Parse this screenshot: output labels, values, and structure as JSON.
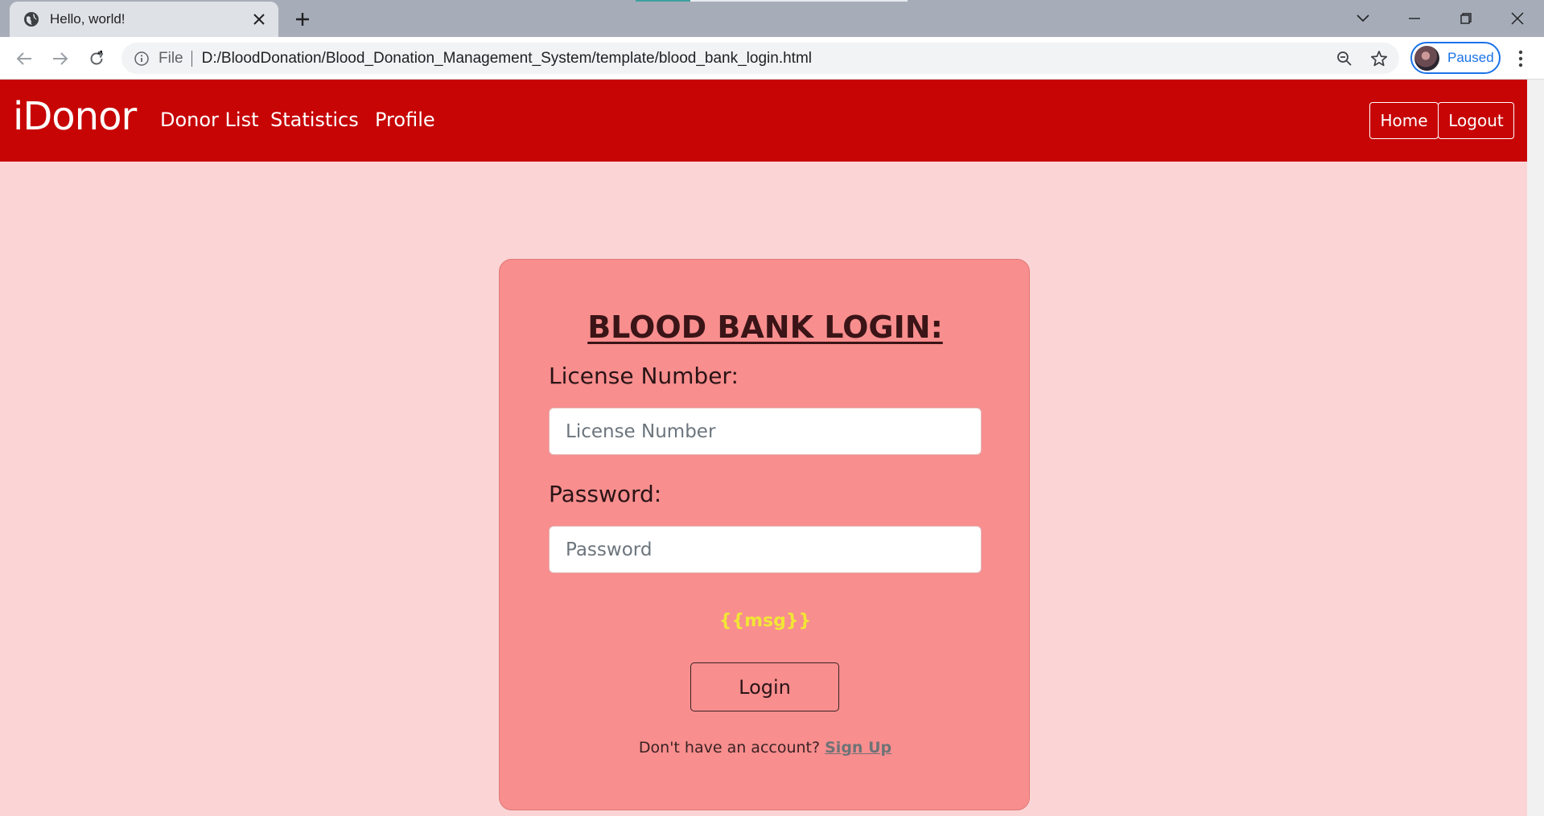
{
  "browser": {
    "tab_title": "Hello, world!",
    "omnibox_scheme": "File",
    "url": "D:/BloodDonation/Blood_Donation_Management_System/template/blood_bank_login.html",
    "profile_status": "Paused",
    "accent_color": "#1a73e8"
  },
  "icons": {
    "tab": "globe-icon",
    "close": "close-icon",
    "new_tab": "plus-icon",
    "back": "back-arrow-icon",
    "forward": "forward-arrow-icon",
    "reload": "reload-icon",
    "info": "info-icon",
    "zoom": "zoom-out-icon",
    "bookmark": "star-icon",
    "menu": "kebab-menu-icon"
  },
  "site": {
    "brand": "iDonor",
    "nav_links": [
      "Donor List",
      "Statistics",
      "Profile"
    ],
    "home_button": "Home",
    "logout_button": "Logout",
    "nav_color": "#c70505",
    "page_bg": "#fbd5d6"
  },
  "login": {
    "title": "BLOOD BANK LOGIN:",
    "license_label": "License Number:",
    "license_placeholder": "License Number",
    "license_value": "",
    "password_label": "Password:",
    "password_placeholder": "Password",
    "password_value": "",
    "message": "{{msg}}",
    "submit_label": "Login",
    "signup_prompt": "Don't have an account?",
    "signup_link": "Sign Up",
    "card_color": "#f88e8e",
    "message_color": "#f1e635"
  }
}
